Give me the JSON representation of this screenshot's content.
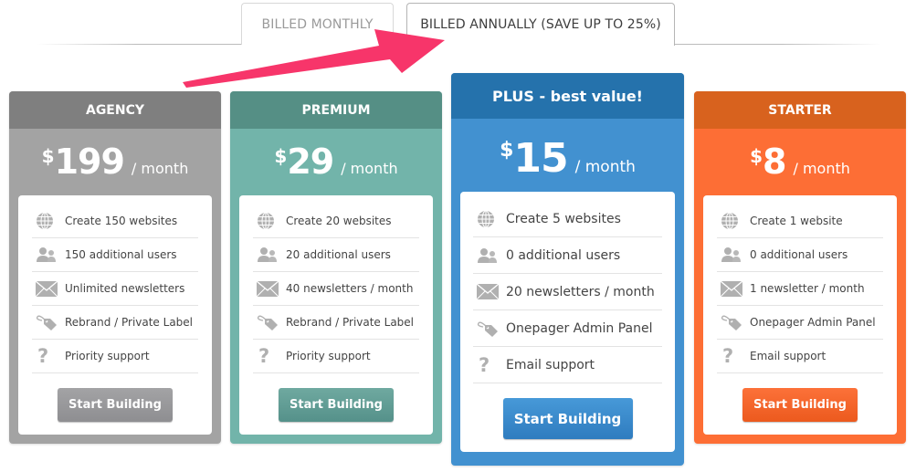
{
  "tabs": [
    {
      "label": "BILLED MONTHLY",
      "active": false
    },
    {
      "label": "BILLED ANNUALLY (SAVE UP TO 25%)",
      "active": true
    }
  ],
  "annotation": {
    "arrow_color": "#f7356a",
    "points_to": "BILLED ANNUALLY (SAVE UP TO 25%)"
  },
  "colors": {
    "agency": {
      "header": "#7f7f7f",
      "body": "#a3a3a3"
    },
    "premium": {
      "header": "#558f85",
      "body": "#72b4aa"
    },
    "plus": {
      "header": "#2572ac",
      "body": "#4291d0"
    },
    "starter": {
      "header": "#d8621e",
      "body": "#fd6e35"
    },
    "icon": "#b0b0b0"
  },
  "plans": [
    {
      "name": "AGENCY",
      "currency": "$",
      "price": "199",
      "period": "/ month",
      "features": [
        {
          "icon": "globe-icon",
          "text": "Create 150 websites"
        },
        {
          "icon": "users-icon",
          "text": "150 additional users"
        },
        {
          "icon": "envelope-icon",
          "text": "Unlimited newsletters"
        },
        {
          "icon": "tag-icon",
          "text": "Rebrand / Private Label"
        },
        {
          "icon": "question-icon",
          "text": "Priority support"
        }
      ],
      "button": "Start Building"
    },
    {
      "name": "PREMIUM",
      "currency": "$",
      "price": "29",
      "period": "/ month",
      "features": [
        {
          "icon": "globe-icon",
          "text": "Create 20 websites"
        },
        {
          "icon": "users-icon",
          "text": "20 additional users"
        },
        {
          "icon": "envelope-icon",
          "text": "40 newsletters / month"
        },
        {
          "icon": "tag-icon",
          "text": "Rebrand / Private Label"
        },
        {
          "icon": "question-icon",
          "text": "Priority support"
        }
      ],
      "button": "Start Building"
    },
    {
      "name": "PLUS - best value!",
      "currency": "$",
      "price": "15",
      "period": "/ month",
      "features": [
        {
          "icon": "globe-icon",
          "text": "Create 5 websites"
        },
        {
          "icon": "users-icon",
          "text": "0 additional users"
        },
        {
          "icon": "envelope-icon",
          "text": "20 newsletters / month"
        },
        {
          "icon": "tag-icon",
          "text": "Onepager Admin Panel"
        },
        {
          "icon": "question-icon",
          "text": "Email support"
        }
      ],
      "button": "Start Building"
    },
    {
      "name": "STARTER",
      "currency": "$",
      "price": "8",
      "period": "/ month",
      "features": [
        {
          "icon": "globe-icon",
          "text": "Create 1 website"
        },
        {
          "icon": "users-icon",
          "text": "0 additional users"
        },
        {
          "icon": "envelope-icon",
          "text": "1 newsletter / month"
        },
        {
          "icon": "tag-icon",
          "text": "Onepager Admin Panel"
        },
        {
          "icon": "question-icon",
          "text": "Email support"
        }
      ],
      "button": "Start Building"
    }
  ]
}
